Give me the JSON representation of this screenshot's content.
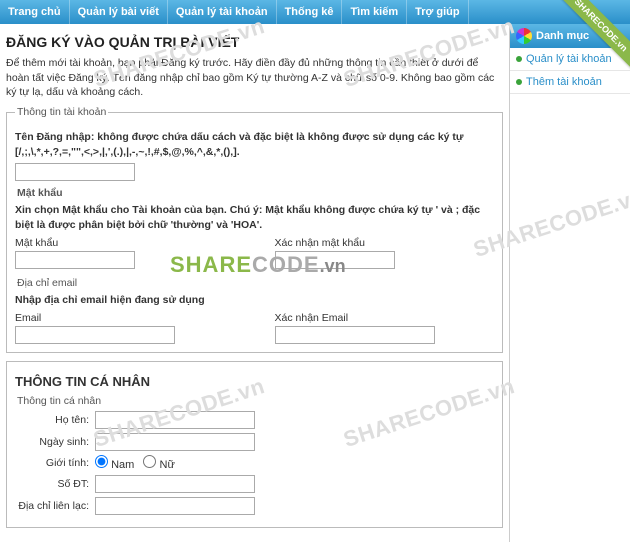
{
  "nav": [
    "Trang chủ",
    "Quản lý bài viết",
    "Quản lý tài khoản",
    "Thống kê",
    "Tìm kiếm",
    "Trợ giúp"
  ],
  "ribbon": "SHARECODE.vn",
  "side": {
    "header": "Danh mục",
    "items": [
      "Quản lý tài khoản",
      "Thêm tài khoản"
    ]
  },
  "page": {
    "title": "ĐĂNG KÝ VÀO QUẢN TRỊ BÀI VIẾT",
    "intro": "Để thêm mới tài khoản, bạn phải Đăng ký trước. Hãy điền đầy đủ những thông tin cần thiết ở dưới để hoàn tất việc Đăng ký. Tên đăng nhập chỉ bao gồm Ký tự thường A-Z và chữ số 0-9. Không bao gồm các ký tự lạ, dấu và khoảng cách."
  },
  "account": {
    "legend": "Thông tin tài khoản",
    "username_note": "Tên Đăng nhập: không được chứa dấu cách và đặc biệt là không được sử dụng các ký tự [/,;,\\,*,+,?,=,\"\",<,>,|,',(.),|,-,~,!,#,$,@,%,^,&,*,(),]."
  },
  "password": {
    "legend": "Mật khẩu",
    "note": "Xin chọn Mật khẩu cho Tài khoản của bạn. Chú ý: Mật khẩu không được chứa ký tự ' và ; đặc biệt là được phân biệt bởi chữ 'thường' và 'HOA'.",
    "lbl_pw": "Mật khẩu",
    "lbl_confirm": "Xác nhận mật khẩu"
  },
  "email": {
    "legend": "Địa chỉ email",
    "note": "Nhập địa chỉ email hiện đang sử dụng",
    "lbl_email": "Email",
    "lbl_confirm": "Xác nhận Email"
  },
  "personal": {
    "title": "THÔNG TIN CÁ NHÂN",
    "legend": "Thông tin cá nhân",
    "lbl_name": "Họ tên:",
    "lbl_dob": "Ngày sinh:",
    "lbl_gender": "Giới tính:",
    "opt_male": "Nam",
    "opt_female": "Nữ",
    "lbl_phone": "Số ĐT:",
    "lbl_addr": "Địa chỉ liên lạc:"
  },
  "watermark": "SHARECODE.vn",
  "logo": {
    "a": "SHARE",
    "b": "CODE",
    "c": ".vn"
  }
}
